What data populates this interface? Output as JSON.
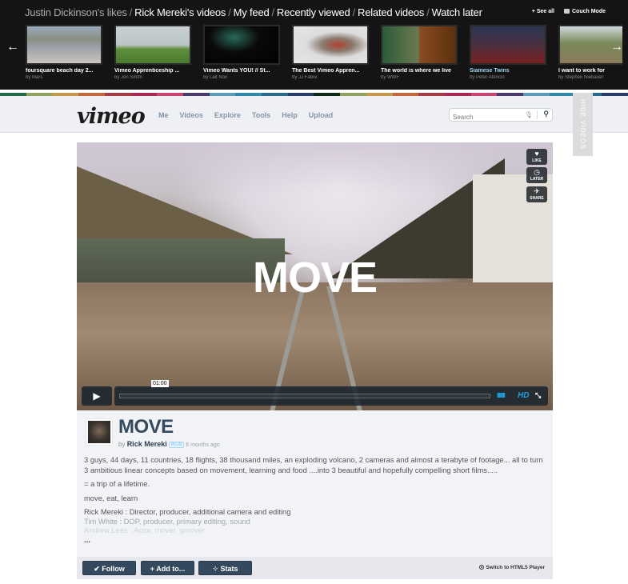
{
  "feed_bar": {
    "breadcrumbs": [
      {
        "label": "Justin Dickinson's likes",
        "active": false
      },
      {
        "label": "Rick Mereki's videos",
        "active": true
      },
      {
        "label": "My feed",
        "active": true
      },
      {
        "label": "Recently viewed",
        "active": true
      },
      {
        "label": "Related videos",
        "active": true
      },
      {
        "label": "Watch later",
        "active": true
      }
    ],
    "separator": "/",
    "see_all": "+ See all",
    "couch_mode": "Couch Mode",
    "arrow_left": "←",
    "arrow_right": "→",
    "thumbnails": [
      {
        "title": "foursquare beach day 2...",
        "by": "by Mars",
        "highlight": false
      },
      {
        "title": "Vimeo Apprenticeship ...",
        "by": "by Jon Smith",
        "highlight": false
      },
      {
        "title": "Vimeo Wants YOU! // St...",
        "by": "by Lait Noir",
        "highlight": false
      },
      {
        "title": "The Best Vimeo Appren...",
        "by": "by JJ Fabre",
        "highlight": false
      },
      {
        "title": "The world is where we live",
        "by": "by WWF",
        "highlight": false
      },
      {
        "title": "Siamese Twins",
        "by": "by Peter Atencio",
        "highlight": true
      },
      {
        "title": "I want to work for",
        "by": "by Stephen Niebauer",
        "highlight": false
      }
    ]
  },
  "stripe_colors": [
    "#1f6b4a",
    "#8fa25f",
    "#c49a4a",
    "#c4683e",
    "#a73b45",
    "#a82a54",
    "#c94574",
    "#4a3a6a",
    "#5e9bb6",
    "#2f8aaa",
    "#2a6a8a",
    "#2a3e6a",
    "#0f2a14",
    "#8fa25f",
    "#c49a4a",
    "#c4683e",
    "#a73b45",
    "#a82a54",
    "#c94574",
    "#4a3a6a",
    "#5e9bb6",
    "#2f8aaa",
    "#2a6a8a",
    "#2a3e6a"
  ],
  "header": {
    "logo": "vimeo",
    "nav": [
      "Me",
      "Videos",
      "Explore",
      "Tools",
      "Help",
      "Upload"
    ],
    "search_placeholder": "Search",
    "hide_videos": "HIDE VIDEOS"
  },
  "player": {
    "overlay_title": "MOVE",
    "side_buttons": [
      {
        "icon": "♥",
        "label": "LIKE"
      },
      {
        "icon": "◷",
        "label": "LATER"
      },
      {
        "icon": "✈",
        "label": "SHARE"
      }
    ],
    "play_icon": "▶",
    "time": "01:00",
    "progress_fraction": 0,
    "volume_icon": "IIIIIIII",
    "hd_label": "HD",
    "fullscreen_icon": "⤡"
  },
  "video": {
    "title": "MOVE",
    "by_prefix": "by",
    "author": "Rick Mereki",
    "badge": "PLUS",
    "age": "6 months ago",
    "description": [
      "3 guys, 44 days, 11 countries, 18 flights, 38 thousand miles, an exploding volcano, 2 cameras and almost a terabyte of footage... all to turn 3 ambitious linear concepts based on movement, learning and food ....into 3 beautiful and hopefully compelling short films.....",
      "= a trip of a lifetime.",
      "move, eat, learn"
    ],
    "credits": [
      "Rick Mereki : Director, producer, additional camera and editing",
      "Tim White : DOP, producer, primary editing, sound",
      "Andrew Lees : Actor, mover, groover"
    ],
    "more": "..."
  },
  "actions": {
    "follow": "✔ Follow",
    "add_to": "+ Add to...",
    "stats": "⁘ Stats",
    "html5_switch": "Switch to HTML5 Player"
  }
}
